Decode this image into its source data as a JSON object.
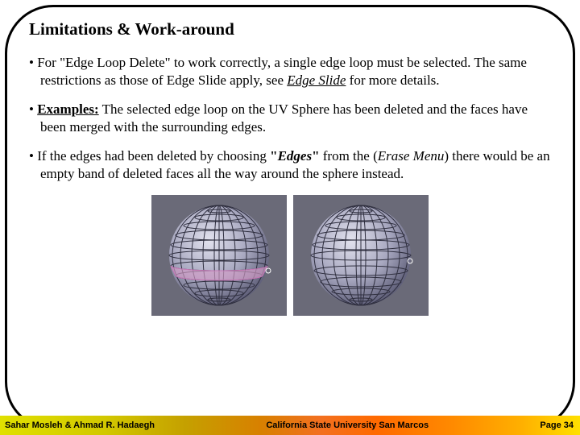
{
  "heading": "Limitations & Work-around",
  "bullets": {
    "b1_pre": "For \"Edge Loop Delete\" to work correctly, a single edge loop must be selected. The same restrictions as those of Edge Slide apply, see ",
    "b1_em": "Edge Slide",
    "b1_post": " for more details.",
    "b2_label": "Examples:",
    "b2_rest": " The selected edge loop on the UV Sphere has been deleted and the faces have been merged with the surrounding edges.",
    "b3_pre": "If the edges had been deleted by choosing ",
    "b3_q1": "\"",
    "b3_em1": "Edges",
    "b3_q2": "\"",
    "b3_mid": " from the (",
    "b3_em2": "Erase Menu",
    "b3_post": ") there would be an empty band of deleted faces all the way around the sphere instead."
  },
  "footer": {
    "left": "Sahar Mosleh & Ahmad R. Hadaegh",
    "center": "California State University San Marcos",
    "page_label": "Page ",
    "page_num": "34"
  }
}
